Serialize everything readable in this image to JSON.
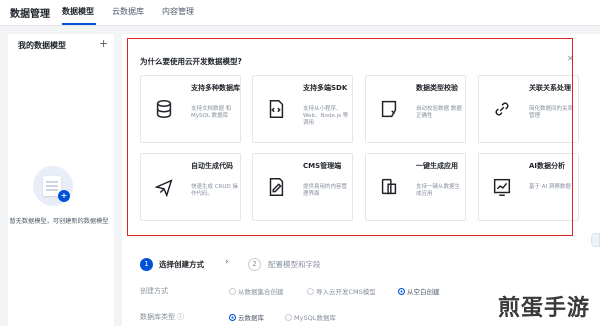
{
  "topbar": {
    "brand": "数据管理",
    "tabs": [
      {
        "label": "数据模型",
        "active": true
      },
      {
        "label": "云数据库",
        "active": false
      },
      {
        "label": "内容管理",
        "active": false
      }
    ]
  },
  "sidebar": {
    "title": "我的数据模型",
    "add_symbol": "+",
    "empty_text": "暂无数据模型，可创建新的数据模型",
    "badge_symbol": "+"
  },
  "intro": {
    "title": "为什么要使用云开发数据模型?",
    "close_symbol": "✕",
    "cards": [
      {
        "name": "支持多种数据库",
        "desc": "支持文档数据 和 MySQL 数据库",
        "icon": "database-icon"
      },
      {
        "name": "支持多端SDK",
        "desc": "支持从小程序、Web、Node.js 等调用",
        "icon": "code-file-icon"
      },
      {
        "name": "数据类型校验",
        "desc": "自动校验数据 数据正确性",
        "icon": "shield-icon"
      },
      {
        "name": "关联关系处理",
        "desc": "简化数据间的关系管理",
        "icon": "link-icon"
      },
      {
        "name": "自动生成代码",
        "desc": "快速生成 CRUD 操作代码。",
        "icon": "paper-plane-icon"
      },
      {
        "name": "CMS管理端",
        "desc": "提供易用的内容管理界面",
        "icon": "edit-doc-icon"
      },
      {
        "name": "一键生成应用",
        "desc": "支持一键从数据生成应用",
        "icon": "app-icon"
      },
      {
        "name": "AI数据分析",
        "desc": "基于 AI 洞察数据",
        "icon": "chart-icon"
      }
    ]
  },
  "steps": [
    {
      "num": "1",
      "label": "选择创建方式",
      "active": true
    },
    {
      "num": "2",
      "label": "配置模型和字段",
      "active": false
    }
  ],
  "step_arrow": "›",
  "form": {
    "create_method": {
      "label": "创建方式",
      "options": [
        {
          "label": "从数据集合创建",
          "selected": false
        },
        {
          "label": "导入云开发CMS模型",
          "selected": false
        },
        {
          "label": "从空白创建",
          "selected": true
        }
      ]
    },
    "db_type": {
      "label": "数据库类型 ⓘ",
      "options": [
        {
          "label": "云数据库",
          "selected": true
        },
        {
          "label": "MySQL数据库",
          "selected": false
        }
      ]
    }
  },
  "watermark": "煎蛋手游",
  "colors": {
    "accent": "#0052d9",
    "frame": "#e02424"
  }
}
